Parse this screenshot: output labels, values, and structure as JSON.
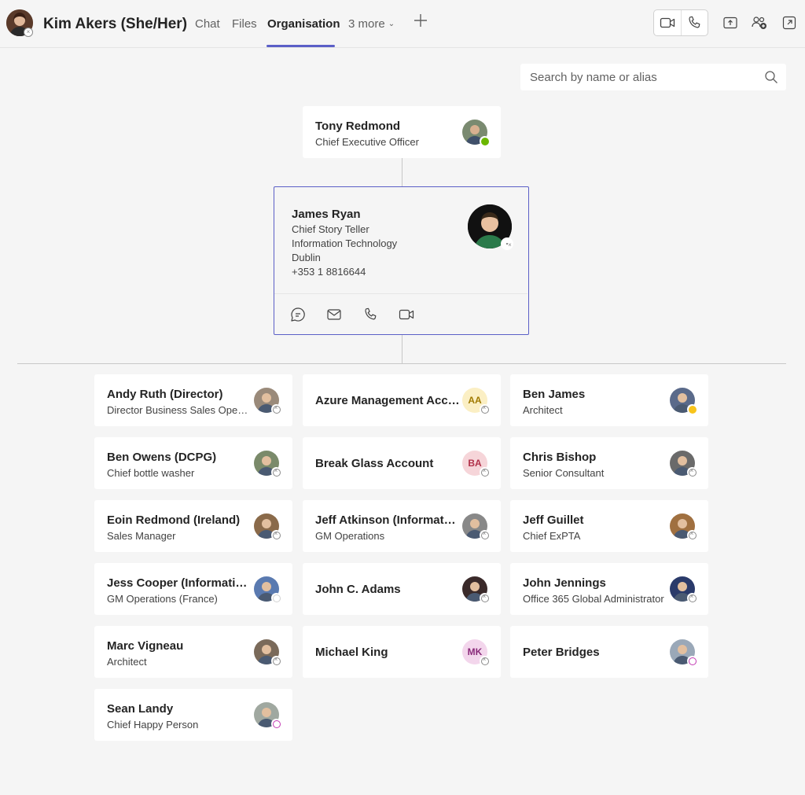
{
  "header": {
    "user_name": "Kim Akers (She/Her)",
    "tabs": [
      {
        "label": "Chat"
      },
      {
        "label": "Files"
      },
      {
        "label": "Organisation"
      },
      {
        "label": "3 more"
      }
    ],
    "active_tab": "Organisation"
  },
  "search": {
    "placeholder": "Search by name or alias"
  },
  "manager": {
    "name": "Tony Redmond",
    "title": "Chief Executive Officer",
    "presence": "available"
  },
  "focus": {
    "name": "James Ryan",
    "title": "Chief Story Teller",
    "department": "Information Technology",
    "location": "Dublin",
    "phone": "+353 1 8816644",
    "presence": "offline"
  },
  "reports": [
    {
      "name": "Andy Ruth (Director)",
      "title": "Director Business Sales Operations",
      "avatar": "photo",
      "color": "#9a8a7a",
      "presence": "offline"
    },
    {
      "name": "Azure Management Account",
      "title": "",
      "avatar": "initials",
      "initials": "AA",
      "bg": "#fbefc4",
      "fg": "#a07a00",
      "presence": "offline"
    },
    {
      "name": "Ben James",
      "title": "Architect",
      "avatar": "photo",
      "color": "#5a6a8a",
      "presence": "away"
    },
    {
      "name": "Ben Owens (DCPG)",
      "title": "Chief bottle washer",
      "avatar": "photo",
      "color": "#7a8a6a",
      "presence": "offline"
    },
    {
      "name": "Break Glass Account",
      "title": "",
      "avatar": "initials",
      "initials": "BA",
      "bg": "#f6d5d9",
      "fg": "#b1314a",
      "presence": "offline"
    },
    {
      "name": "Chris Bishop",
      "title": "Senior Consultant",
      "avatar": "photo",
      "color": "#6a6a6a",
      "presence": "offline"
    },
    {
      "name": "Eoin Redmond (Ireland)",
      "title": "Sales Manager",
      "avatar": "photo",
      "color": "#8a6a4a",
      "presence": "offline"
    },
    {
      "name": "Jeff Atkinson (Information Technology)",
      "title": "GM Operations",
      "avatar": "photo",
      "color": "#888888",
      "presence": "offline"
    },
    {
      "name": "Jeff Guillet",
      "title": "Chief ExPTA",
      "avatar": "photo",
      "color": "#a07040",
      "presence": "offline"
    },
    {
      "name": "Jess Cooper (Information Technology)",
      "title": "GM Operations (France)",
      "avatar": "photo",
      "color": "#5a7ab0",
      "presence": "empty"
    },
    {
      "name": "John C. Adams",
      "title": "",
      "avatar": "photo",
      "color": "#3a2a2a",
      "presence": "offline"
    },
    {
      "name": "John Jennings",
      "title": "Office 365 Global Administrator",
      "avatar": "photo",
      "color": "#2a3a6a",
      "presence": "offline"
    },
    {
      "name": "Marc Vigneau",
      "title": "Architect",
      "avatar": "photo",
      "color": "#7a6a5a",
      "presence": "offline"
    },
    {
      "name": "Michael King",
      "title": "",
      "avatar": "initials",
      "initials": "MK",
      "bg": "#f3d6ec",
      "fg": "#8a2a7a",
      "presence": "offline"
    },
    {
      "name": "Peter Bridges",
      "title": "",
      "avatar": "photo",
      "color": "#9aa8b8",
      "presence": "oof"
    },
    {
      "name": "Sean Landy",
      "title": "Chief Happy Person",
      "avatar": "photo",
      "color": "#a0a8a0",
      "presence": "oof"
    }
  ],
  "colors": {
    "accent": "#5b5fc7",
    "available": "#6bb700",
    "away": "#f8c41b",
    "oof": "#c239b3"
  }
}
